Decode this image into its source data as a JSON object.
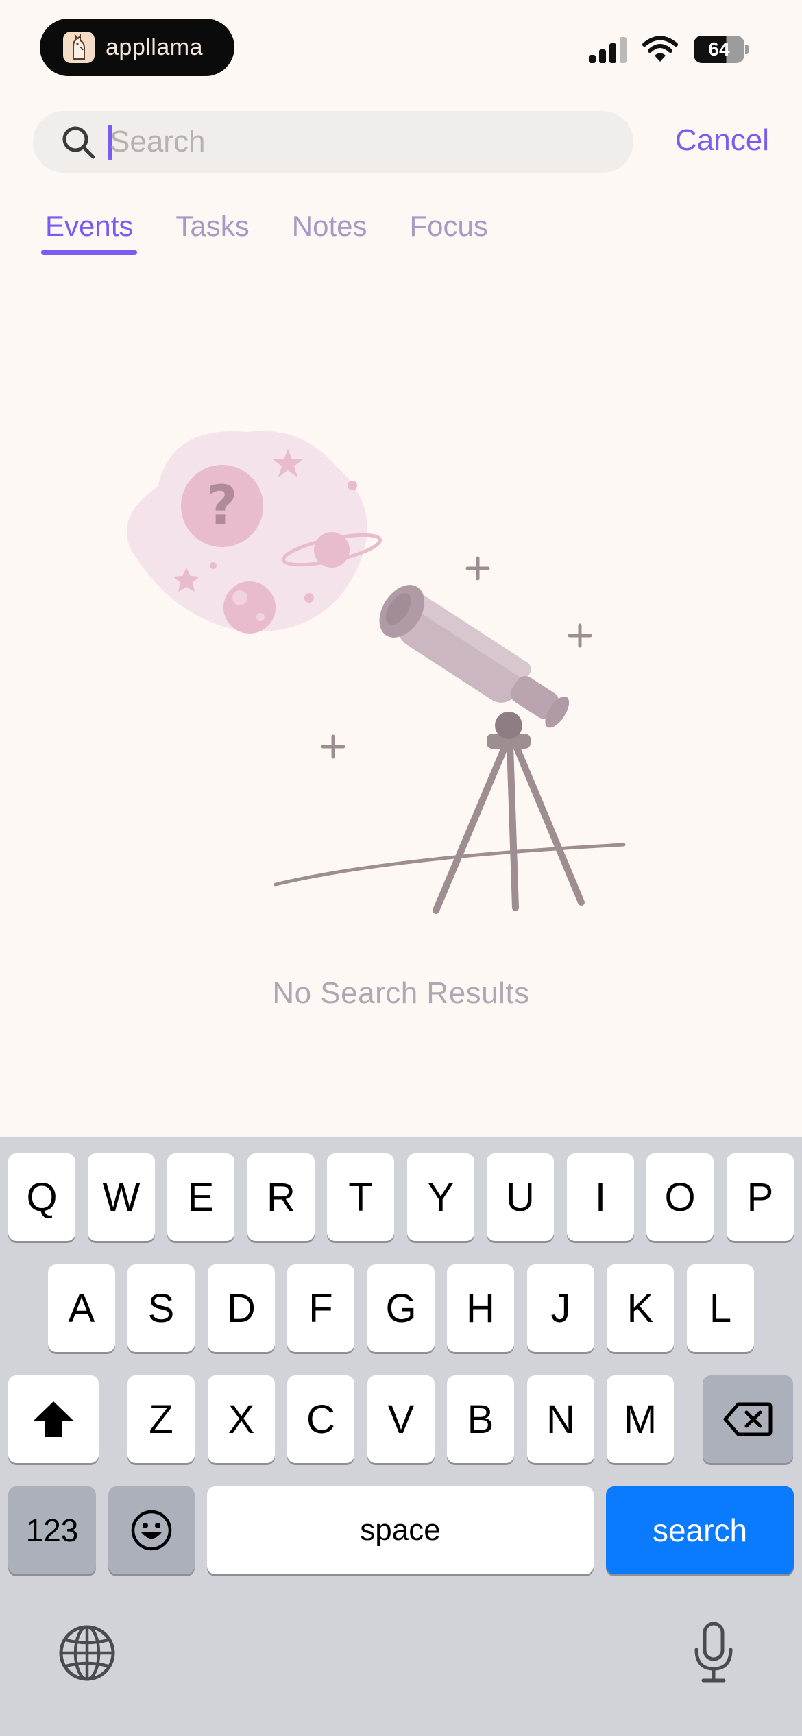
{
  "status_bar": {
    "app_name": "appllama",
    "battery": "64"
  },
  "search": {
    "placeholder": "Search",
    "value": "",
    "cancel_label": "Cancel"
  },
  "tabs": [
    {
      "label": "Events",
      "active": true
    },
    {
      "label": "Tasks",
      "active": false
    },
    {
      "label": "Notes",
      "active": false
    },
    {
      "label": "Focus",
      "active": false
    }
  ],
  "empty_state": {
    "message": "No Search Results",
    "illustration_icon": "telescope-icon"
  },
  "keyboard": {
    "row1": [
      "Q",
      "W",
      "E",
      "R",
      "T",
      "Y",
      "U",
      "I",
      "O",
      "P"
    ],
    "row2": [
      "A",
      "S",
      "D",
      "F",
      "G",
      "H",
      "J",
      "K",
      "L"
    ],
    "row3": [
      "Z",
      "X",
      "C",
      "V",
      "B",
      "N",
      "M"
    ],
    "numbers_label": "123",
    "space_label": "space",
    "search_label": "search"
  },
  "colors": {
    "accent": "#7A5CF0",
    "background": "#FEF8F4",
    "search_key": "#0A7AFF"
  }
}
